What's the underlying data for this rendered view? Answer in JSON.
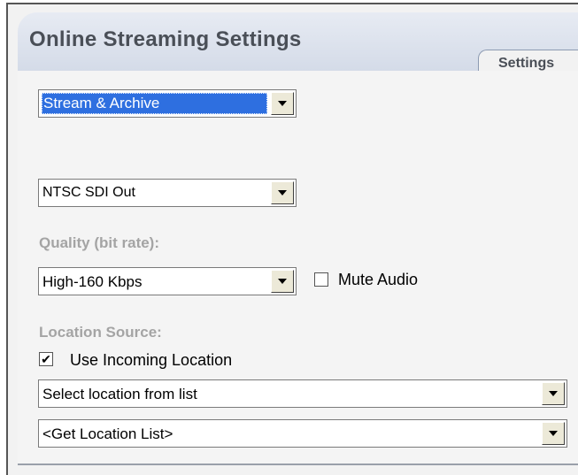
{
  "panel": {
    "title": "Online Streaming Settings",
    "tab_label": "Settings"
  },
  "mode_select": {
    "value": "Stream & Archive"
  },
  "output_select": {
    "value": "NTSC SDI Out"
  },
  "quality": {
    "label": "Quality (bit rate):",
    "value": "High-160 Kbps",
    "mute_audio_label": "Mute Audio",
    "mute_audio_checked": false
  },
  "location": {
    "label": "Location Source:",
    "use_incoming_label": "Use Incoming Location",
    "use_incoming_checked": true,
    "list_select_value": "Select location from list",
    "get_list_value": "<Get Location List>"
  },
  "icons": {
    "dropdown_arrow": "chevron-down-icon",
    "checkmark": "checkmark-icon"
  },
  "colors": {
    "highlight": "#2e6fe0",
    "label_gray": "#a4a4a4",
    "title_gray": "#4a4f57"
  }
}
